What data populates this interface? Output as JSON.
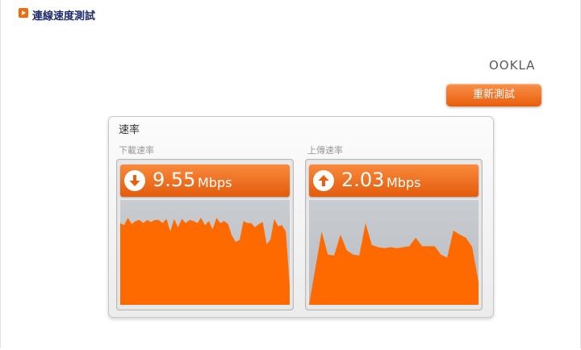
{
  "header": {
    "title": "連線速度測試",
    "bullet_icon": "orange-play-bullet-icon"
  },
  "logo": {
    "text": "OOKLA"
  },
  "retest": {
    "label": "重新測試"
  },
  "panel": {
    "title": "速率",
    "download": {
      "label": "下載速率",
      "value": "9.55",
      "unit": "Mbps",
      "icon": "down-arrow-icon",
      "history": [
        78,
        76,
        83,
        77,
        80,
        81,
        78,
        81,
        79,
        81,
        81,
        78,
        82,
        70,
        82,
        74,
        82,
        78,
        81,
        80,
        78,
        83,
        76,
        80,
        72,
        83,
        78,
        80,
        77,
        66,
        60,
        62,
        80,
        78,
        78,
        74,
        77,
        79,
        58,
        62,
        82,
        75,
        76,
        70,
        18
      ]
    },
    "upload": {
      "label": "上傳速率",
      "value": "2.03",
      "unit": "Mbps",
      "icon": "up-arrow-icon",
      "history": [
        0,
        35,
        70,
        48,
        47,
        67,
        52,
        48,
        47,
        78,
        57,
        55,
        54,
        55,
        54,
        55,
        56,
        64,
        56,
        56,
        56,
        48,
        45,
        71,
        67,
        64,
        55,
        22
      ]
    },
    "accent_color": "#f26a10",
    "graph_color": "#ff6a00"
  }
}
